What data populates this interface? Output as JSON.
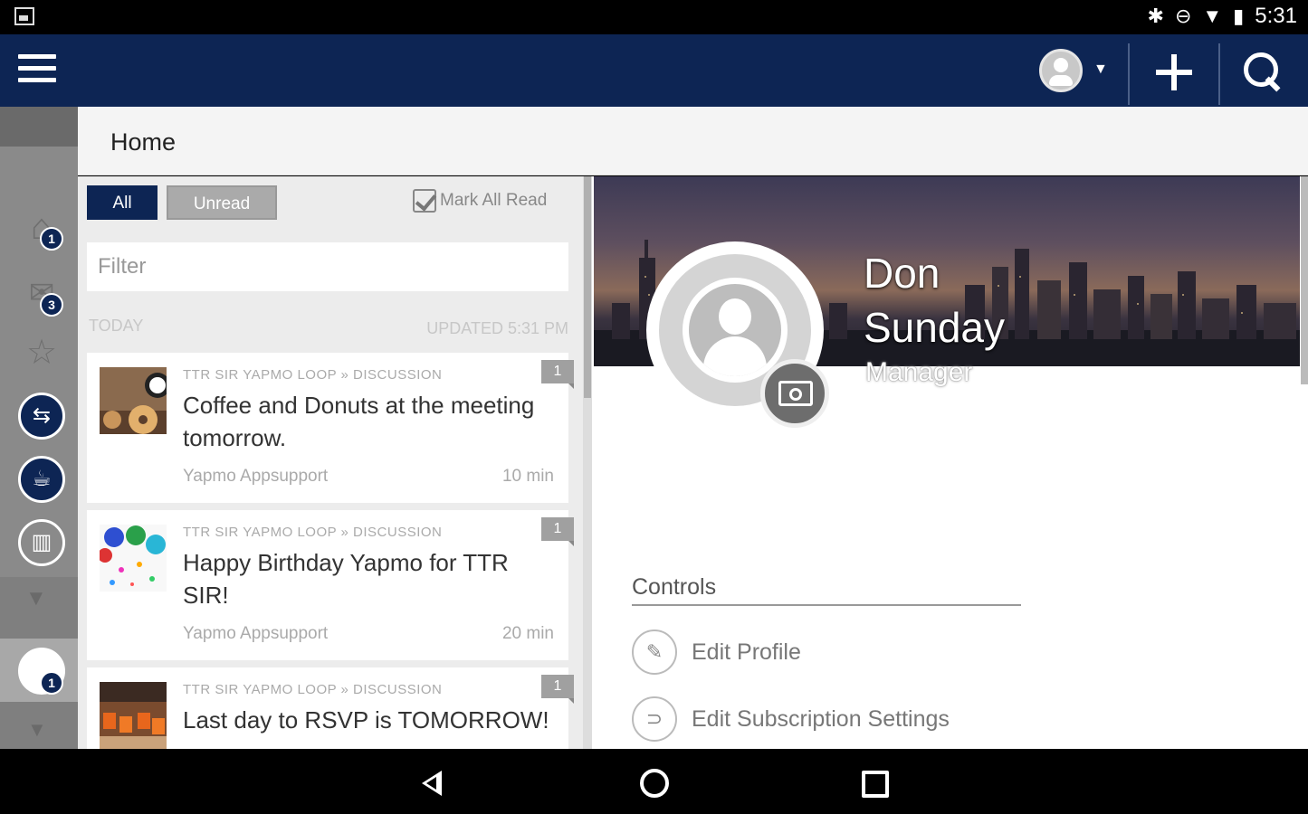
{
  "status_bar": {
    "time": "5:31",
    "icons": [
      "bluetooth-icon",
      "dnd-icon",
      "wifi-icon",
      "battery-icon"
    ]
  },
  "app_bar": {
    "background": "#0d2554",
    "actions": [
      "menu-icon",
      "avatar-icon",
      "add-icon",
      "search-icon"
    ]
  },
  "rail": {
    "items": [
      {
        "name": "home",
        "badge": "1"
      },
      {
        "name": "messages",
        "badge": "3"
      },
      {
        "name": "favorites",
        "badge": ""
      },
      {
        "name": "app-1",
        "badge": ""
      },
      {
        "name": "app-2",
        "badge": ""
      },
      {
        "name": "app-3",
        "badge": ""
      },
      {
        "name": "loop",
        "badge": "1"
      }
    ]
  },
  "page": {
    "title": "Home"
  },
  "feed": {
    "filters": {
      "all_label": "All",
      "unread_label": "Unread",
      "mark_all_label": "Mark All Read"
    },
    "filter_placeholder": "Filter",
    "section_label": "TODAY",
    "updated_label": "UPDATED 5:31 PM",
    "items": [
      {
        "source": "TTR SIR YAPMO LOOP » DISCUSSION",
        "title": "Coffee and Donuts at the meeting tomorrow.",
        "author": "Yapmo Appsupport",
        "time": "10 min",
        "count": "1"
      },
      {
        "source": "TTR SIR YAPMO LOOP » DISCUSSION",
        "title": "Happy Birthday Yapmo for TTR SIR!",
        "author": "Yapmo Appsupport",
        "time": "20 min",
        "count": "1"
      },
      {
        "source": "TTR SIR YAPMO LOOP » DISCUSSION",
        "title": "Last day to RSVP is TOMORROW!",
        "author": "",
        "time": "",
        "count": "1"
      }
    ]
  },
  "profile": {
    "first_name": "Don",
    "last_name": "Sunday",
    "role": "Manager",
    "controls_heading": "Controls",
    "controls": [
      {
        "label": "Edit Profile",
        "icon": "pencil-icon",
        "glyph": "✎"
      },
      {
        "label": "Edit Subscription Settings",
        "icon": "rss-icon",
        "glyph": "⊃"
      }
    ]
  }
}
